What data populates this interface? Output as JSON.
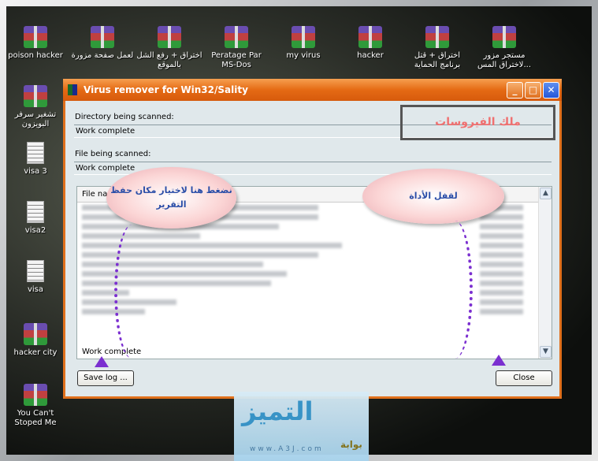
{
  "desktop": {
    "top_icons": [
      {
        "label": "poison hacker",
        "type": "rar"
      },
      {
        "label": "لعمل صفحة مزورة",
        "type": "rar"
      },
      {
        "label": "اختراق + رفع الشل بالموقع",
        "type": "rar"
      },
      {
        "label": "Peratage Par MS-Dos",
        "type": "rar"
      },
      {
        "label": "my virus",
        "type": "rar"
      },
      {
        "label": "hacker",
        "type": "rar"
      },
      {
        "label": "اختراق + قتل برنامج الحماية",
        "type": "rar"
      },
      {
        "label": "مستجر مزور ...لاختراق المس",
        "type": "rar"
      }
    ],
    "left_icons": [
      {
        "label": "تشغير سرفر البويزون",
        "type": "rar"
      },
      {
        "label": "visa 3",
        "type": "text"
      },
      {
        "label": "visa2",
        "type": "text"
      },
      {
        "label": "visa",
        "type": "text"
      },
      {
        "label": "hacker city",
        "type": "rar"
      },
      {
        "label": "You Can't Stoped Me",
        "type": "rar"
      }
    ]
  },
  "window": {
    "title": "Virus remover for Win32/Sality",
    "minimize": "_",
    "maximize": "□",
    "close": "✕",
    "brand_box": "ملك الفيروسات",
    "dir_label": "Directory being scanned:",
    "dir_value": "Work complete",
    "file_label": "File being scanned:",
    "file_value": "Work complete",
    "list_header": "File name",
    "list_status": "Work complete",
    "save_button": "Save log ...",
    "close_button": "Close"
  },
  "annotations": {
    "left_cloud": "نضغط هنا لاختيار مكان حفظ التقرير",
    "right_cloud": "لقفل الأداة",
    "arrow_color": "#7b2fd0"
  },
  "logo": {
    "text": "التميز",
    "url": "www.A3J.com",
    "sub": "بوابة"
  },
  "colors": {
    "titlebar": "#e56a14",
    "client": "#e0e8eb",
    "close_btn": "#2556d8"
  }
}
